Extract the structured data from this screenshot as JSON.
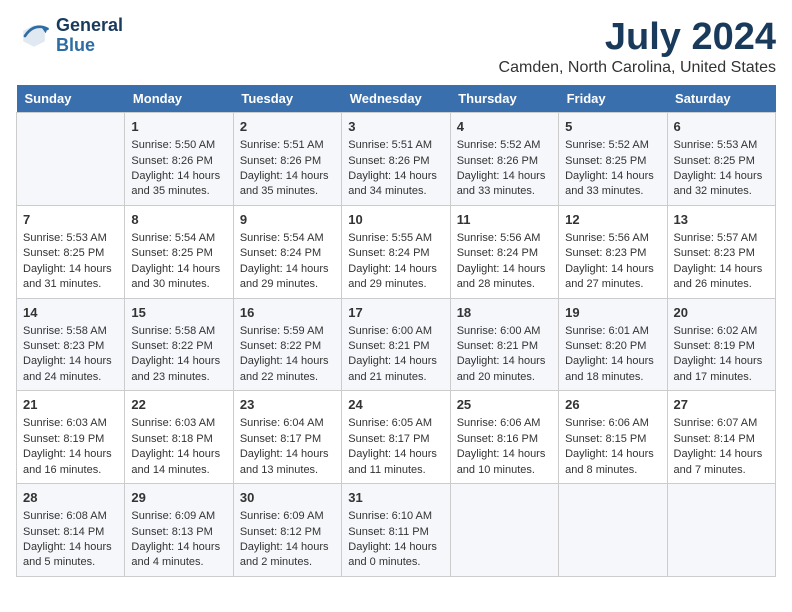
{
  "logo": {
    "line1": "General",
    "line2": "Blue"
  },
  "title": "July 2024",
  "subtitle": "Camden, North Carolina, United States",
  "header_days": [
    "Sunday",
    "Monday",
    "Tuesday",
    "Wednesday",
    "Thursday",
    "Friday",
    "Saturday"
  ],
  "weeks": [
    [
      {
        "day": "",
        "content": ""
      },
      {
        "day": "1",
        "content": "Sunrise: 5:50 AM\nSunset: 8:26 PM\nDaylight: 14 hours\nand 35 minutes."
      },
      {
        "day": "2",
        "content": "Sunrise: 5:51 AM\nSunset: 8:26 PM\nDaylight: 14 hours\nand 35 minutes."
      },
      {
        "day": "3",
        "content": "Sunrise: 5:51 AM\nSunset: 8:26 PM\nDaylight: 14 hours\nand 34 minutes."
      },
      {
        "day": "4",
        "content": "Sunrise: 5:52 AM\nSunset: 8:26 PM\nDaylight: 14 hours\nand 33 minutes."
      },
      {
        "day": "5",
        "content": "Sunrise: 5:52 AM\nSunset: 8:25 PM\nDaylight: 14 hours\nand 33 minutes."
      },
      {
        "day": "6",
        "content": "Sunrise: 5:53 AM\nSunset: 8:25 PM\nDaylight: 14 hours\nand 32 minutes."
      }
    ],
    [
      {
        "day": "7",
        "content": "Sunrise: 5:53 AM\nSunset: 8:25 PM\nDaylight: 14 hours\nand 31 minutes."
      },
      {
        "day": "8",
        "content": "Sunrise: 5:54 AM\nSunset: 8:25 PM\nDaylight: 14 hours\nand 30 minutes."
      },
      {
        "day": "9",
        "content": "Sunrise: 5:54 AM\nSunset: 8:24 PM\nDaylight: 14 hours\nand 29 minutes."
      },
      {
        "day": "10",
        "content": "Sunrise: 5:55 AM\nSunset: 8:24 PM\nDaylight: 14 hours\nand 29 minutes."
      },
      {
        "day": "11",
        "content": "Sunrise: 5:56 AM\nSunset: 8:24 PM\nDaylight: 14 hours\nand 28 minutes."
      },
      {
        "day": "12",
        "content": "Sunrise: 5:56 AM\nSunset: 8:23 PM\nDaylight: 14 hours\nand 27 minutes."
      },
      {
        "day": "13",
        "content": "Sunrise: 5:57 AM\nSunset: 8:23 PM\nDaylight: 14 hours\nand 26 minutes."
      }
    ],
    [
      {
        "day": "14",
        "content": "Sunrise: 5:58 AM\nSunset: 8:23 PM\nDaylight: 14 hours\nand 24 minutes."
      },
      {
        "day": "15",
        "content": "Sunrise: 5:58 AM\nSunset: 8:22 PM\nDaylight: 14 hours\nand 23 minutes."
      },
      {
        "day": "16",
        "content": "Sunrise: 5:59 AM\nSunset: 8:22 PM\nDaylight: 14 hours\nand 22 minutes."
      },
      {
        "day": "17",
        "content": "Sunrise: 6:00 AM\nSunset: 8:21 PM\nDaylight: 14 hours\nand 21 minutes."
      },
      {
        "day": "18",
        "content": "Sunrise: 6:00 AM\nSunset: 8:21 PM\nDaylight: 14 hours\nand 20 minutes."
      },
      {
        "day": "19",
        "content": "Sunrise: 6:01 AM\nSunset: 8:20 PM\nDaylight: 14 hours\nand 18 minutes."
      },
      {
        "day": "20",
        "content": "Sunrise: 6:02 AM\nSunset: 8:19 PM\nDaylight: 14 hours\nand 17 minutes."
      }
    ],
    [
      {
        "day": "21",
        "content": "Sunrise: 6:03 AM\nSunset: 8:19 PM\nDaylight: 14 hours\nand 16 minutes."
      },
      {
        "day": "22",
        "content": "Sunrise: 6:03 AM\nSunset: 8:18 PM\nDaylight: 14 hours\nand 14 minutes."
      },
      {
        "day": "23",
        "content": "Sunrise: 6:04 AM\nSunset: 8:17 PM\nDaylight: 14 hours\nand 13 minutes."
      },
      {
        "day": "24",
        "content": "Sunrise: 6:05 AM\nSunset: 8:17 PM\nDaylight: 14 hours\nand 11 minutes."
      },
      {
        "day": "25",
        "content": "Sunrise: 6:06 AM\nSunset: 8:16 PM\nDaylight: 14 hours\nand 10 minutes."
      },
      {
        "day": "26",
        "content": "Sunrise: 6:06 AM\nSunset: 8:15 PM\nDaylight: 14 hours\nand 8 minutes."
      },
      {
        "day": "27",
        "content": "Sunrise: 6:07 AM\nSunset: 8:14 PM\nDaylight: 14 hours\nand 7 minutes."
      }
    ],
    [
      {
        "day": "28",
        "content": "Sunrise: 6:08 AM\nSunset: 8:14 PM\nDaylight: 14 hours\nand 5 minutes."
      },
      {
        "day": "29",
        "content": "Sunrise: 6:09 AM\nSunset: 8:13 PM\nDaylight: 14 hours\nand 4 minutes."
      },
      {
        "day": "30",
        "content": "Sunrise: 6:09 AM\nSunset: 8:12 PM\nDaylight: 14 hours\nand 2 minutes."
      },
      {
        "day": "31",
        "content": "Sunrise: 6:10 AM\nSunset: 8:11 PM\nDaylight: 14 hours\nand 0 minutes."
      },
      {
        "day": "",
        "content": ""
      },
      {
        "day": "",
        "content": ""
      },
      {
        "day": "",
        "content": ""
      }
    ]
  ]
}
